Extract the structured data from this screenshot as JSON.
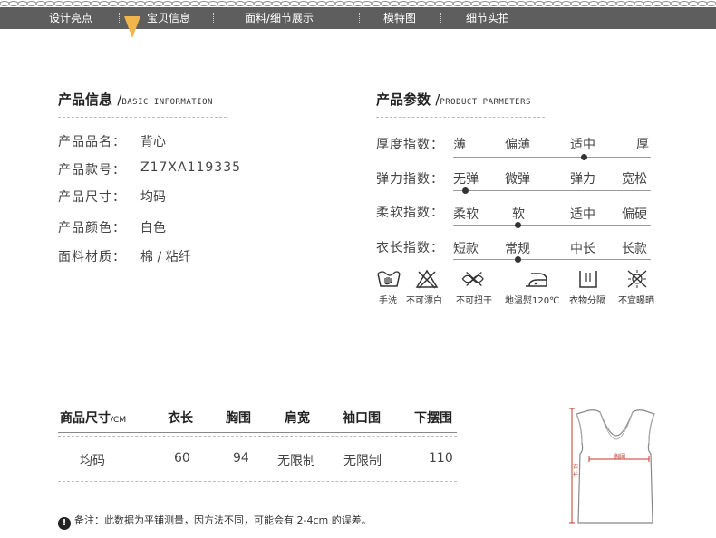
{
  "nav": {
    "tabs": [
      "设计亮点",
      "宝贝信息",
      "面料/细节展示",
      "模特图",
      "细节实拍"
    ],
    "active_tab": "宝贝信息",
    "accent_color": "#f0b54b",
    "bar_color": "#5e5e5e"
  },
  "info": {
    "title": "产品信息",
    "subtitle": "BASIC INFORMATION",
    "rows": [
      {
        "label": "产品品名：",
        "value": "背心"
      },
      {
        "label": "产品款号：",
        "value": "Z17XA119335"
      },
      {
        "label": "产品尺寸：",
        "value": "均码"
      },
      {
        "label": "产品颜色：",
        "value": "白色"
      },
      {
        "label": "面料材质：",
        "value": "棉 / 粘纤"
      }
    ]
  },
  "params": {
    "title": "产品参数",
    "subtitle": "PRODUCT PARMETERS",
    "rows": [
      {
        "label": "厚度指数：",
        "options": [
          "薄",
          "偏薄",
          "适中",
          "厚"
        ],
        "selected": 2
      },
      {
        "label": "弹力指数：",
        "options": [
          "无弹",
          "微弹",
          "弹力",
          "宽松"
        ],
        "selected": 0
      },
      {
        "label": "柔软指数：",
        "options": [
          "柔软",
          "软",
          "适中",
          "偏硬"
        ],
        "selected": 1
      },
      {
        "label": "衣长指数：",
        "options": [
          "短款",
          "常规",
          "中长",
          "长款"
        ],
        "selected": 1
      }
    ]
  },
  "care": [
    {
      "icon": "hand-wash-icon",
      "label": "手洗"
    },
    {
      "icon": "no-bleach-icon",
      "label": "不可漂白"
    },
    {
      "icon": "no-wring-icon",
      "label": "不可扭干"
    },
    {
      "icon": "low-iron-icon",
      "label": "地温熨120℃"
    },
    {
      "icon": "hang-dry-icon",
      "label": "衣物分隔"
    },
    {
      "icon": "no-sun-dry-icon",
      "label": "不宜曝晒"
    }
  ],
  "size_table": {
    "headers": [
      "商品尺寸",
      "衣长",
      "胸围",
      "肩宽",
      "袖口围",
      "下摆围"
    ],
    "unit": "/CM",
    "rows": [
      [
        "均码",
        "60",
        "94",
        "无限制",
        "无限制",
        "110"
      ]
    ]
  },
  "note": {
    "text": "备注：此数据为平铺测量，因方法不同，可能会有 2-4cm 的误差。"
  },
  "diagram": {
    "chest_label": "胸围",
    "length_label": "衣长",
    "measure_color": "#c0392b"
  }
}
